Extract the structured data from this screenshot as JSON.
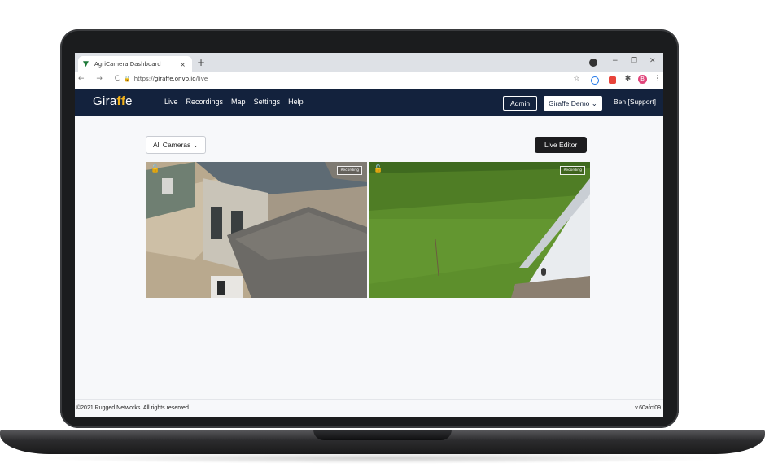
{
  "browser": {
    "tab_title": "AgriCamera Dashboard",
    "tab_close": "×",
    "new_tab": "+",
    "url_scheme": "https://",
    "url_host": "giraffe.onvp.io",
    "url_path": "/live",
    "nav_icons": "← → C",
    "lock_icon": "🔒",
    "window_controls": [
      "−",
      "❐",
      "✕"
    ]
  },
  "app": {
    "logo_pre": "Gira",
    "logo_ff": "ff",
    "logo_post": "e",
    "nav": [
      "Live",
      "Recordings",
      "Map",
      "Settings",
      "Help"
    ],
    "admin_label": "Admin",
    "org_select": "Giraffe Demo",
    "user_label": "Ben [Support]",
    "accent_color": "#f2b21b",
    "header_color": "#13223d"
  },
  "controls": {
    "camera_filter": "All Cameras",
    "live_editor_label": "Live Editor"
  },
  "feeds": [
    {
      "recording_label": "Recording",
      "lock_icon": "unlock-icon"
    },
    {
      "recording_label": "Recording",
      "lock_icon": "unlock-icon"
    }
  ],
  "footer": {
    "copyright": "©2021 Rugged Networks. All rights reserved.",
    "version": "v.60afcf09"
  }
}
